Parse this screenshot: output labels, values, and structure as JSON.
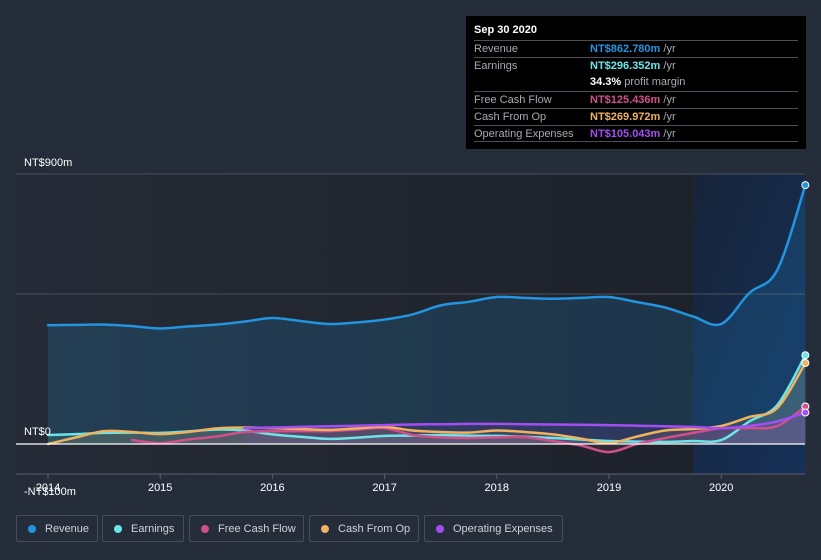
{
  "tooltip": {
    "date": "Sep 30 2020",
    "rows": [
      {
        "label": "Revenue",
        "value": "NT$862.780m",
        "unit": " /yr",
        "color": "#2394df"
      },
      {
        "label": "Earnings",
        "value": "NT$296.352m",
        "unit": " /yr",
        "color": "#6ce5e8"
      },
      {
        "label": "",
        "value": "34.3%",
        "unit": " profit margin",
        "color": "#ffffff"
      },
      {
        "label": "Free Cash Flow",
        "value": "NT$125.436m",
        "unit": " /yr",
        "color": "#d1508c"
      },
      {
        "label": "Cash From Op",
        "value": "NT$269.972m",
        "unit": " /yr",
        "color": "#f0b25e"
      },
      {
        "label": "Operating Expenses",
        "value": "NT$105.043m",
        "unit": " /yr",
        "color": "#a54df4"
      }
    ]
  },
  "legend": [
    {
      "label": "Revenue",
      "color": "#2394df"
    },
    {
      "label": "Earnings",
      "color": "#6ce5e8"
    },
    {
      "label": "Free Cash Flow",
      "color": "#d1508c"
    },
    {
      "label": "Cash From Op",
      "color": "#f0b25e"
    },
    {
      "label": "Operating Expenses",
      "color": "#a54df4"
    }
  ],
  "chart_data": {
    "type": "line",
    "title": "",
    "xlabel": "",
    "ylabel": "",
    "unit": "NT$ millions",
    "y_tick_labels": [
      {
        "value": 900,
        "label": "NT$900m"
      },
      {
        "value": 0,
        "label": "NT$0"
      },
      {
        "value": -100,
        "label": "-NT$100m"
      }
    ],
    "gridlines": [
      900,
      500
    ],
    "ylim": [
      -100,
      900
    ],
    "xlim": [
      2013.7,
      2020.75
    ],
    "x_ticks": [
      2014,
      2015,
      2016,
      2017,
      2018,
      2019,
      2020
    ],
    "x_tick_labels": [
      "2014",
      "2015",
      "2016",
      "2017",
      "2018",
      "2019",
      "2020"
    ],
    "highlight_range": [
      2019.75,
      2020.75
    ],
    "x": [
      2014.0,
      2014.25,
      2014.5,
      2014.75,
      2015.0,
      2015.25,
      2015.5,
      2015.75,
      2016.0,
      2016.25,
      2016.5,
      2016.75,
      2017.0,
      2017.25,
      2017.5,
      2017.75,
      2018.0,
      2018.25,
      2018.5,
      2018.75,
      2019.0,
      2019.25,
      2019.5,
      2019.75,
      2020.0,
      2020.25,
      2020.5,
      2020.75
    ],
    "series": [
      {
        "name": "Revenue",
        "color": "#2394df",
        "values": [
          396,
          397,
          398,
          393,
          385,
          392,
          398,
          408,
          420,
          410,
          400,
          405,
          415,
          432,
          462,
          474,
          490,
          487,
          484,
          487,
          490,
          473,
          455,
          425,
          400,
          503,
          580,
          863
        ]
      },
      {
        "name": "Earnings",
        "color": "#6ce5e8",
        "values": [
          30,
          33,
          37,
          38,
          37,
          42,
          48,
          45,
          32,
          24,
          17,
          21,
          27,
          28,
          30,
          28,
          27,
          24,
          20,
          15,
          10,
          8,
          7,
          10,
          13,
          75,
          130,
          296
        ]
      },
      {
        "name": "Free Cash Flow",
        "color": "#d1508c",
        "values": [
          null,
          null,
          null,
          13,
          3,
          15,
          25,
          40,
          42,
          43,
          43,
          48,
          53,
          30,
          22,
          20,
          22,
          23,
          10,
          -5,
          -27,
          0,
          20,
          37,
          53,
          53,
          60,
          125
        ]
      },
      {
        "name": "Cash From Op",
        "color": "#f0b25e",
        "values": [
          0,
          22,
          43,
          40,
          33,
          40,
          52,
          55,
          53,
          50,
          47,
          52,
          57,
          45,
          40,
          38,
          45,
          40,
          32,
          18,
          3,
          25,
          45,
          50,
          60,
          90,
          120,
          270
        ]
      },
      {
        "name": "Operating Expenses",
        "color": "#a54df4",
        "values": [
          null,
          null,
          null,
          null,
          null,
          null,
          null,
          53,
          55,
          57,
          59,
          61,
          63,
          65,
          66,
          67,
          67,
          66,
          65,
          64,
          63,
          61,
          59,
          57,
          53,
          60,
          75,
          105
        ]
      }
    ],
    "legend_position": "bottom-left"
  }
}
